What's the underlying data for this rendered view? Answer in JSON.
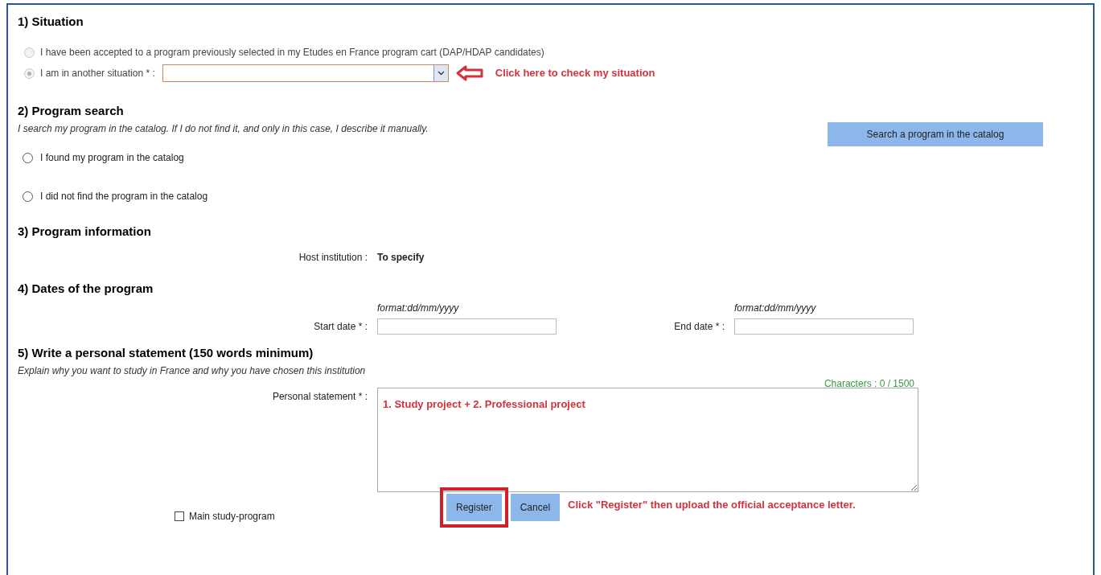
{
  "situation": {
    "heading": "1) Situation",
    "options": [
      {
        "label": "I have been accepted to a program previously selected in my Etudes en France program cart (DAP/HDAP candidates)",
        "selected": false,
        "disabled": true
      },
      {
        "label": "I am in another situation * :",
        "selected": true,
        "disabled": true
      }
    ],
    "annotation": "Click here to check my situation"
  },
  "program_search": {
    "heading": "2) Program search",
    "hint": "I search my program in the catalog. If I do not find it, and only in this case, I describe it manually.",
    "search_button": "Search a program in the catalog",
    "options": [
      {
        "label": "I found my program in the catalog",
        "selected": false
      },
      {
        "label": "I did not find the program in the catalog",
        "selected": false
      }
    ]
  },
  "program_information": {
    "heading": "3) Program information",
    "label": "Host institution :",
    "value": "To specify"
  },
  "dates": {
    "heading": "4) Dates of the program",
    "fields": [
      {
        "format": "format:dd/mm/yyyy",
        "label": "Start date * :"
      },
      {
        "format": "format:dd/mm/yyyy",
        "label": "End date * :"
      }
    ]
  },
  "statement": {
    "heading": "5) Write a personal statement (150 words minimum)",
    "hint": "Explain why you want to study in France and why you have chosen this institution",
    "counter": "Characters : 0 / 1500",
    "label": "Personal statement * :",
    "value": "1. Study project + 2. Professional project"
  },
  "footer": {
    "checkbox": {
      "label": "Main study-program",
      "checked": false
    },
    "buttons": [
      {
        "label": "Register",
        "highlighted": true
      },
      {
        "label": "Cancel",
        "highlighted": false
      }
    ],
    "annotation": "Click \"Register\" then upload the official acceptance letter."
  }
}
